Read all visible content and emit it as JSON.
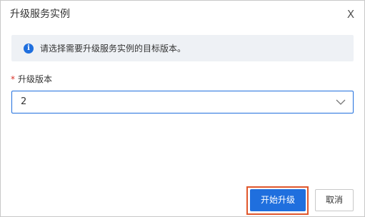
{
  "dialog": {
    "title": "升级服务实例",
    "close_label": "X"
  },
  "notice": {
    "icon": "info-icon",
    "text": "请选择需要升级服务实例的目标版本。"
  },
  "form": {
    "required_mark": "*",
    "version_label": "升级版本",
    "version_value": "2"
  },
  "footer": {
    "start_button": "开始升级",
    "cancel_button": "取消"
  },
  "colors": {
    "primary": "#1f6fde",
    "required": "#d93026",
    "highlight_frame": "#e0562b"
  }
}
